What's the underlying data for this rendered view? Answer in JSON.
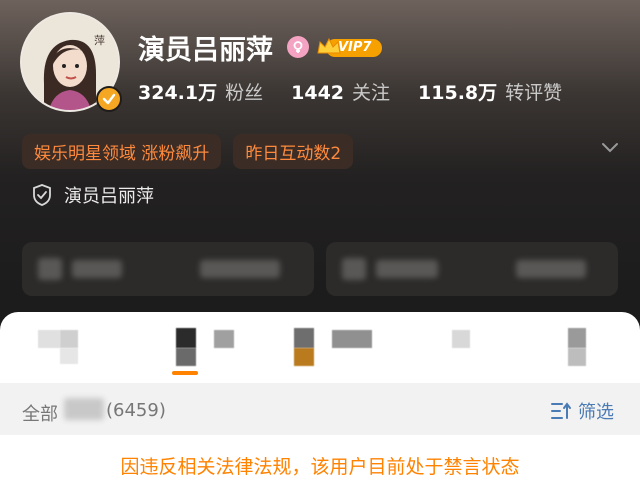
{
  "profile": {
    "name": "演员吕丽萍",
    "vip_label": "VIP7",
    "stats": [
      {
        "value": "324.1万",
        "label": "粉丝"
      },
      {
        "value": "1442",
        "label": "关注"
      },
      {
        "value": "115.8万",
        "label": "转评赞"
      }
    ],
    "tags": [
      "娱乐明星领域 涨粉飙升",
      "昨日互动数2"
    ],
    "identity_label": "演员吕丽萍"
  },
  "filter_bar": {
    "all_label": "全部",
    "count": "(6459)",
    "filter_label": "筛选"
  },
  "notice": "因违反相关法律法规，该用户目前处于禁言状态",
  "colors": {
    "accent_orange": "#ff8200",
    "link_blue": "#4a7bb5",
    "tag_bg": "#3b2c25"
  }
}
